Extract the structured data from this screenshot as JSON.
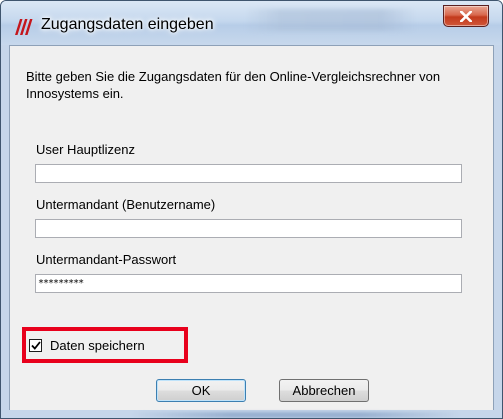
{
  "window": {
    "title": "Zugangsdaten eingeben",
    "app_icon": "innosystems-logo-icon",
    "close_icon": "close-icon"
  },
  "instructions": "Bitte geben Sie die Zugangsdaten für den Online-Vergleichsrechner von Innosystems ein.",
  "fields": {
    "user_label": "User Hauptlizenz",
    "user_value": "",
    "submandant_label": "Untermandant (Benutzername)",
    "submandant_value": "",
    "password_label": "Untermandant-Passwort",
    "password_value": "*********"
  },
  "save_checkbox": {
    "label": "Daten speichern",
    "checked": true,
    "highlight_color": "#e8001c"
  },
  "buttons": {
    "ok": "OK",
    "cancel": "Abbrechen"
  }
}
